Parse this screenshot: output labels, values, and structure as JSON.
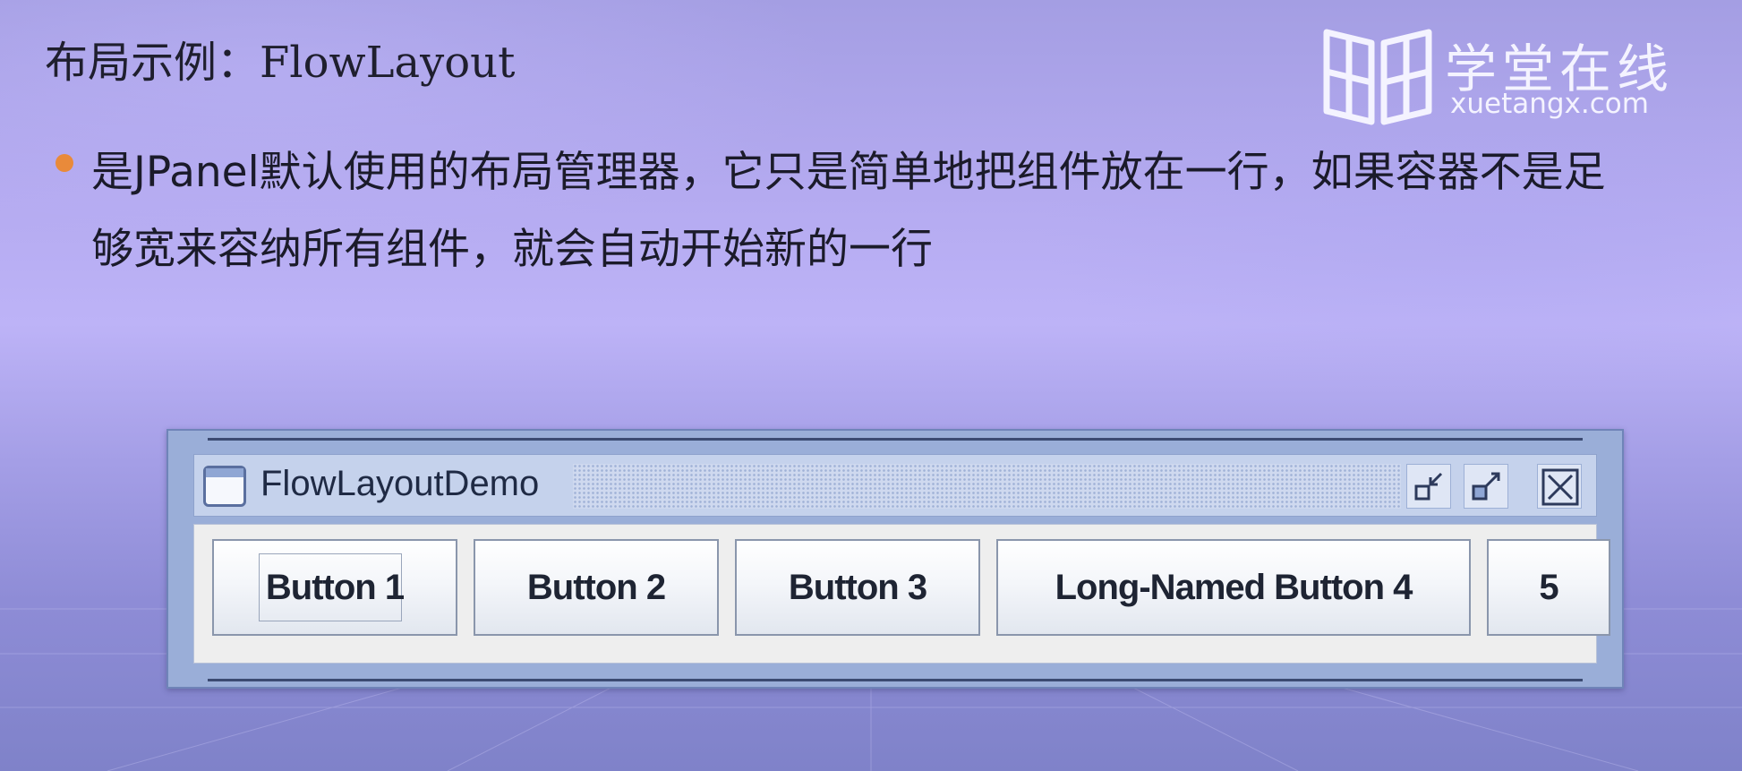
{
  "slide": {
    "title": "布局示例：FlowLayout",
    "bullet": "是JPanel默认使用的布局管理器，它只是简单地把组件放在一行，如果容器不是足够宽来容纳所有组件，就会自动开始新的一行"
  },
  "logo": {
    "name": "学堂在线",
    "url": "xuetangx.com"
  },
  "window": {
    "title": "FlowLayoutDemo",
    "icon": "window-icon",
    "controls": {
      "iconify": "iconify-icon",
      "maximize": "maximize-icon",
      "close": "close-icon"
    }
  },
  "buttons": [
    {
      "label": "Button 1"
    },
    {
      "label": "Button 2"
    },
    {
      "label": "Button 3"
    },
    {
      "label": "Long-Named Button 4"
    },
    {
      "label": "5"
    }
  ],
  "colors": {
    "bullet": "#e98a3a",
    "window_frame": "#9aaed8",
    "titlebar": "#c5d2ec",
    "content_pane": "#eeeeee"
  }
}
